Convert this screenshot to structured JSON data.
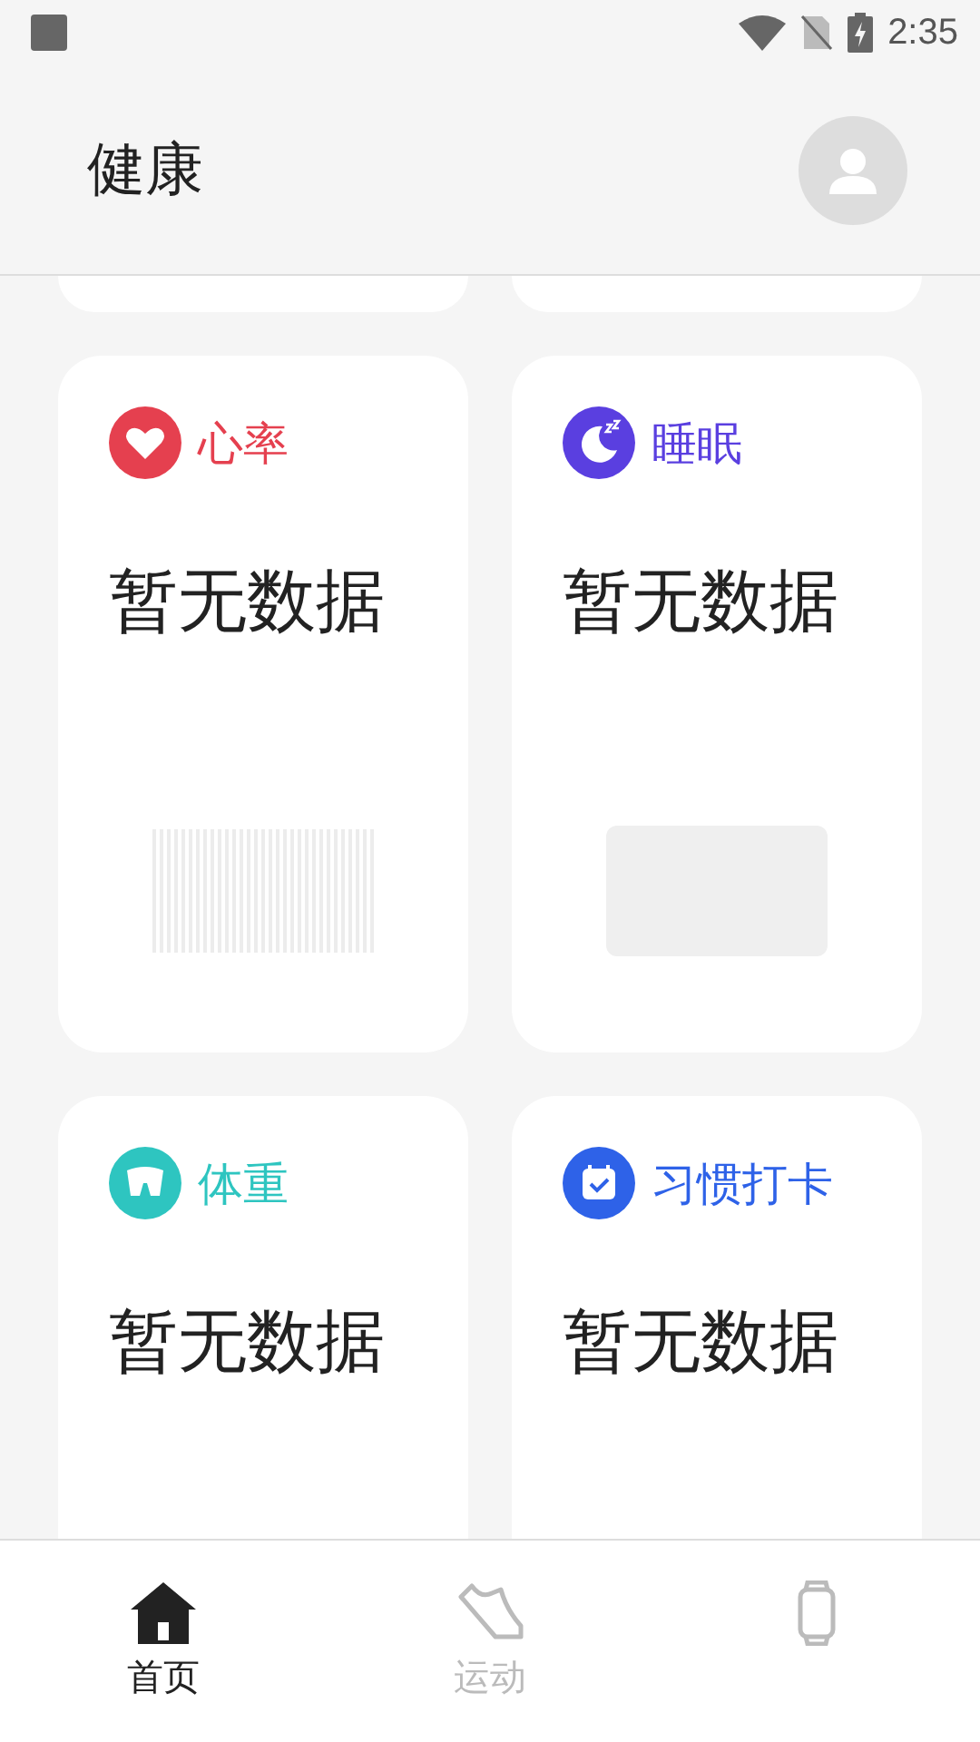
{
  "status_bar": {
    "time": "2:35"
  },
  "header": {
    "title": "健康"
  },
  "cards": [
    {
      "kind": "heart",
      "title": "心率",
      "color": "#e5404f",
      "value": "暂无数据",
      "preview": {
        "kind": "stripes"
      }
    },
    {
      "kind": "sleep",
      "title": "睡眠",
      "color": "#5a3fe0",
      "value": "暂无数据",
      "preview": {
        "kind": "block"
      }
    },
    {
      "kind": "weight",
      "title": "体重",
      "color": "#2ec5c0",
      "value": "暂无数据"
    },
    {
      "kind": "habit",
      "title": "习惯打卡",
      "color": "#2e62e8",
      "value": "暂无数据"
    }
  ],
  "nav": [
    {
      "kind": "home",
      "label": "首页",
      "selected": true
    },
    {
      "kind": "run",
      "label": "运动",
      "selected": false
    },
    {
      "kind": "watch",
      "selected": false
    }
  ]
}
